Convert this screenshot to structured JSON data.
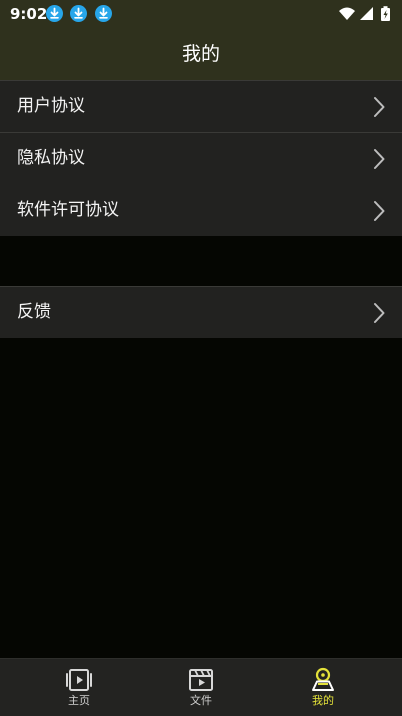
{
  "status_bar": {
    "time": "9:02",
    "notification_icons": [
      "download-icon",
      "download-icon",
      "download-icon"
    ],
    "right_icons": [
      "wifi-icon",
      "signal-icon",
      "battery-icon"
    ]
  },
  "app_bar": {
    "title": "我的"
  },
  "menu_group_1": {
    "items": [
      {
        "label": "用户协议",
        "icon": "chevron-right-icon"
      },
      {
        "label": "隐私协议",
        "icon": "chevron-right-icon"
      },
      {
        "label": "软件许可协议",
        "icon": "chevron-right-icon"
      }
    ]
  },
  "menu_group_2": {
    "items": [
      {
        "label": "反馈",
        "icon": "chevron-right-icon"
      }
    ]
  },
  "bottom_nav": {
    "items": [
      {
        "label": "主页",
        "icon": "video-icon",
        "active": false
      },
      {
        "label": "文件",
        "icon": "film-clapper-icon",
        "active": false
      },
      {
        "label": "我的",
        "icon": "profile-icon",
        "active": true
      }
    ]
  },
  "colors": {
    "header_bg": "#2f311d",
    "page_bg": "#050602",
    "row_bg": "#222220",
    "accent": "#e4e23a",
    "status_icon_blue": "#27a6ea"
  }
}
